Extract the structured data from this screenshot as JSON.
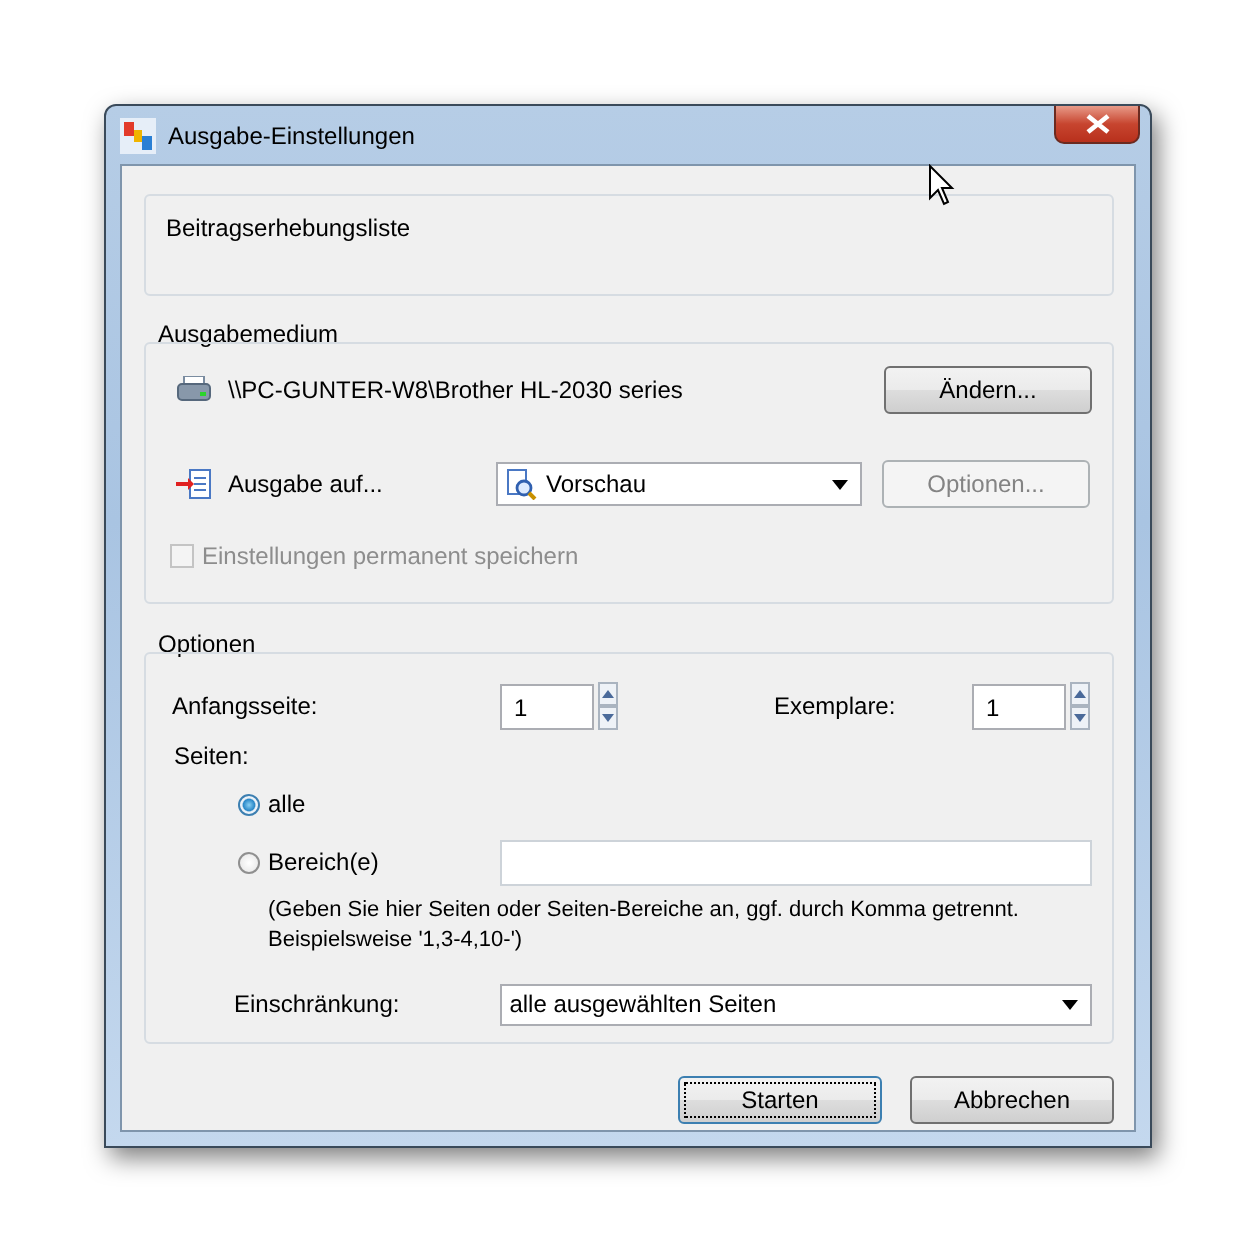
{
  "window": {
    "title": "Ausgabe-Einstellungen"
  },
  "report_name": "Beitragserhebungsliste",
  "output_medium": {
    "label": "Ausgabemedium",
    "printer": "\\\\PC-GUNTER-W8\\Brother HL-2030 series",
    "change_button": {
      "label": "Ändern...",
      "disabled": false
    },
    "output_to_label": "Ausgabe auf...",
    "output_to": {
      "value": "Vorschau"
    },
    "options_button": {
      "label": "Optionen...",
      "disabled": true
    },
    "save_settings": {
      "label": "Einstellungen permanent speichern",
      "checked": false,
      "disabled": true
    }
  },
  "options": {
    "label": "Optionen",
    "start_page": {
      "label": "Anfangsseite:",
      "value": "1"
    },
    "copies": {
      "label": "Exemplare:",
      "value": "1"
    },
    "pages_label": "Seiten:",
    "page_choices": [
      {
        "label": "alle",
        "selected": true
      },
      {
        "label": "Bereich(e)",
        "selected": false
      }
    ],
    "hint": "(Geben Sie hier Seiten oder Seiten-Bereiche an, ggf. durch Komma getrennt. Beispielsweise '1,3-4,10-')",
    "restriction": {
      "label": "Einschränkung:",
      "value": "alle ausgewählten Seiten"
    }
  },
  "buttons": [
    {
      "label": "Starten",
      "default": true
    },
    {
      "label": "Abbrechen",
      "default": false
    }
  ]
}
